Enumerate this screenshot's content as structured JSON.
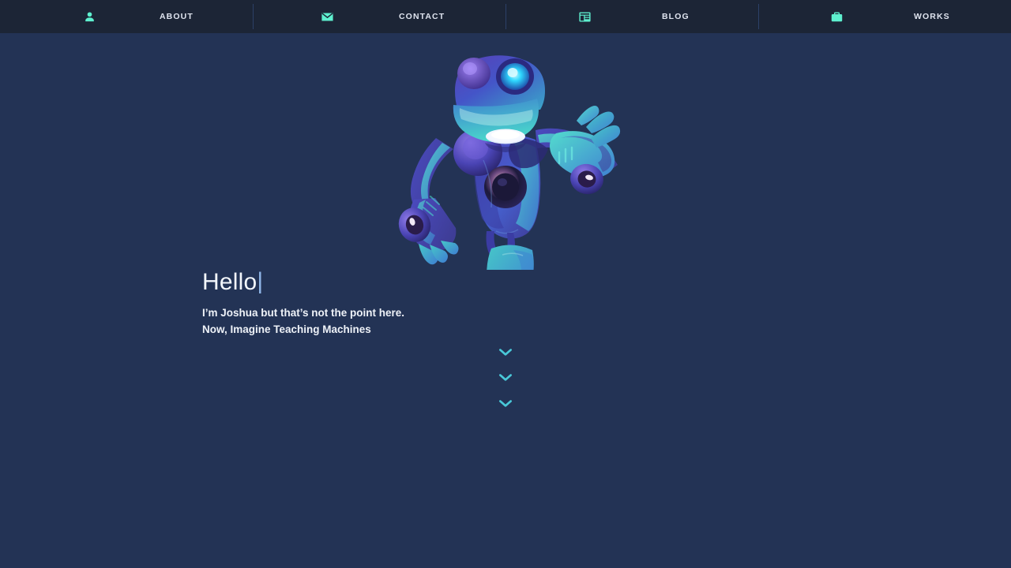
{
  "nav": {
    "items": [
      {
        "label": "ABOUT",
        "icon": "person-icon"
      },
      {
        "label": "CONTACT",
        "icon": "envelope-icon"
      },
      {
        "label": "BLOG",
        "icon": "article-layout-icon"
      },
      {
        "label": "WORKS",
        "icon": "briefcase-icon"
      }
    ],
    "accent_color": "#5ef0cf",
    "background_color": "#1c2536",
    "label_color": "#dfe4ef",
    "divider_color": "#2c4168"
  },
  "hero": {
    "title": "Hello",
    "caret": "|",
    "subtitle": "I’m Joshua but that’s not the point here. Now, Imagine Teaching Machines",
    "title_color": "#f2f6fb",
    "subtitle_color": "#eef2f8",
    "caret_color": "#8fb6e8"
  },
  "illustration": {
    "name": "robot-mascot-pointing",
    "alt": "Blue and purple cartoon robot pointing to the side",
    "colors": {
      "body_purple": "#4a3fa8",
      "body_blue": "#3f5fd0",
      "highlight_teal": "#46d6cf",
      "eye_glow": "#2fd8ff",
      "mouth": "#ffffff",
      "dark_shadow": "#2a2a66"
    }
  },
  "scroll_indicator": {
    "name": "scroll-down-chevrons",
    "count": 3,
    "color": "#49c8d8"
  },
  "page": {
    "background_color": "#233355"
  }
}
